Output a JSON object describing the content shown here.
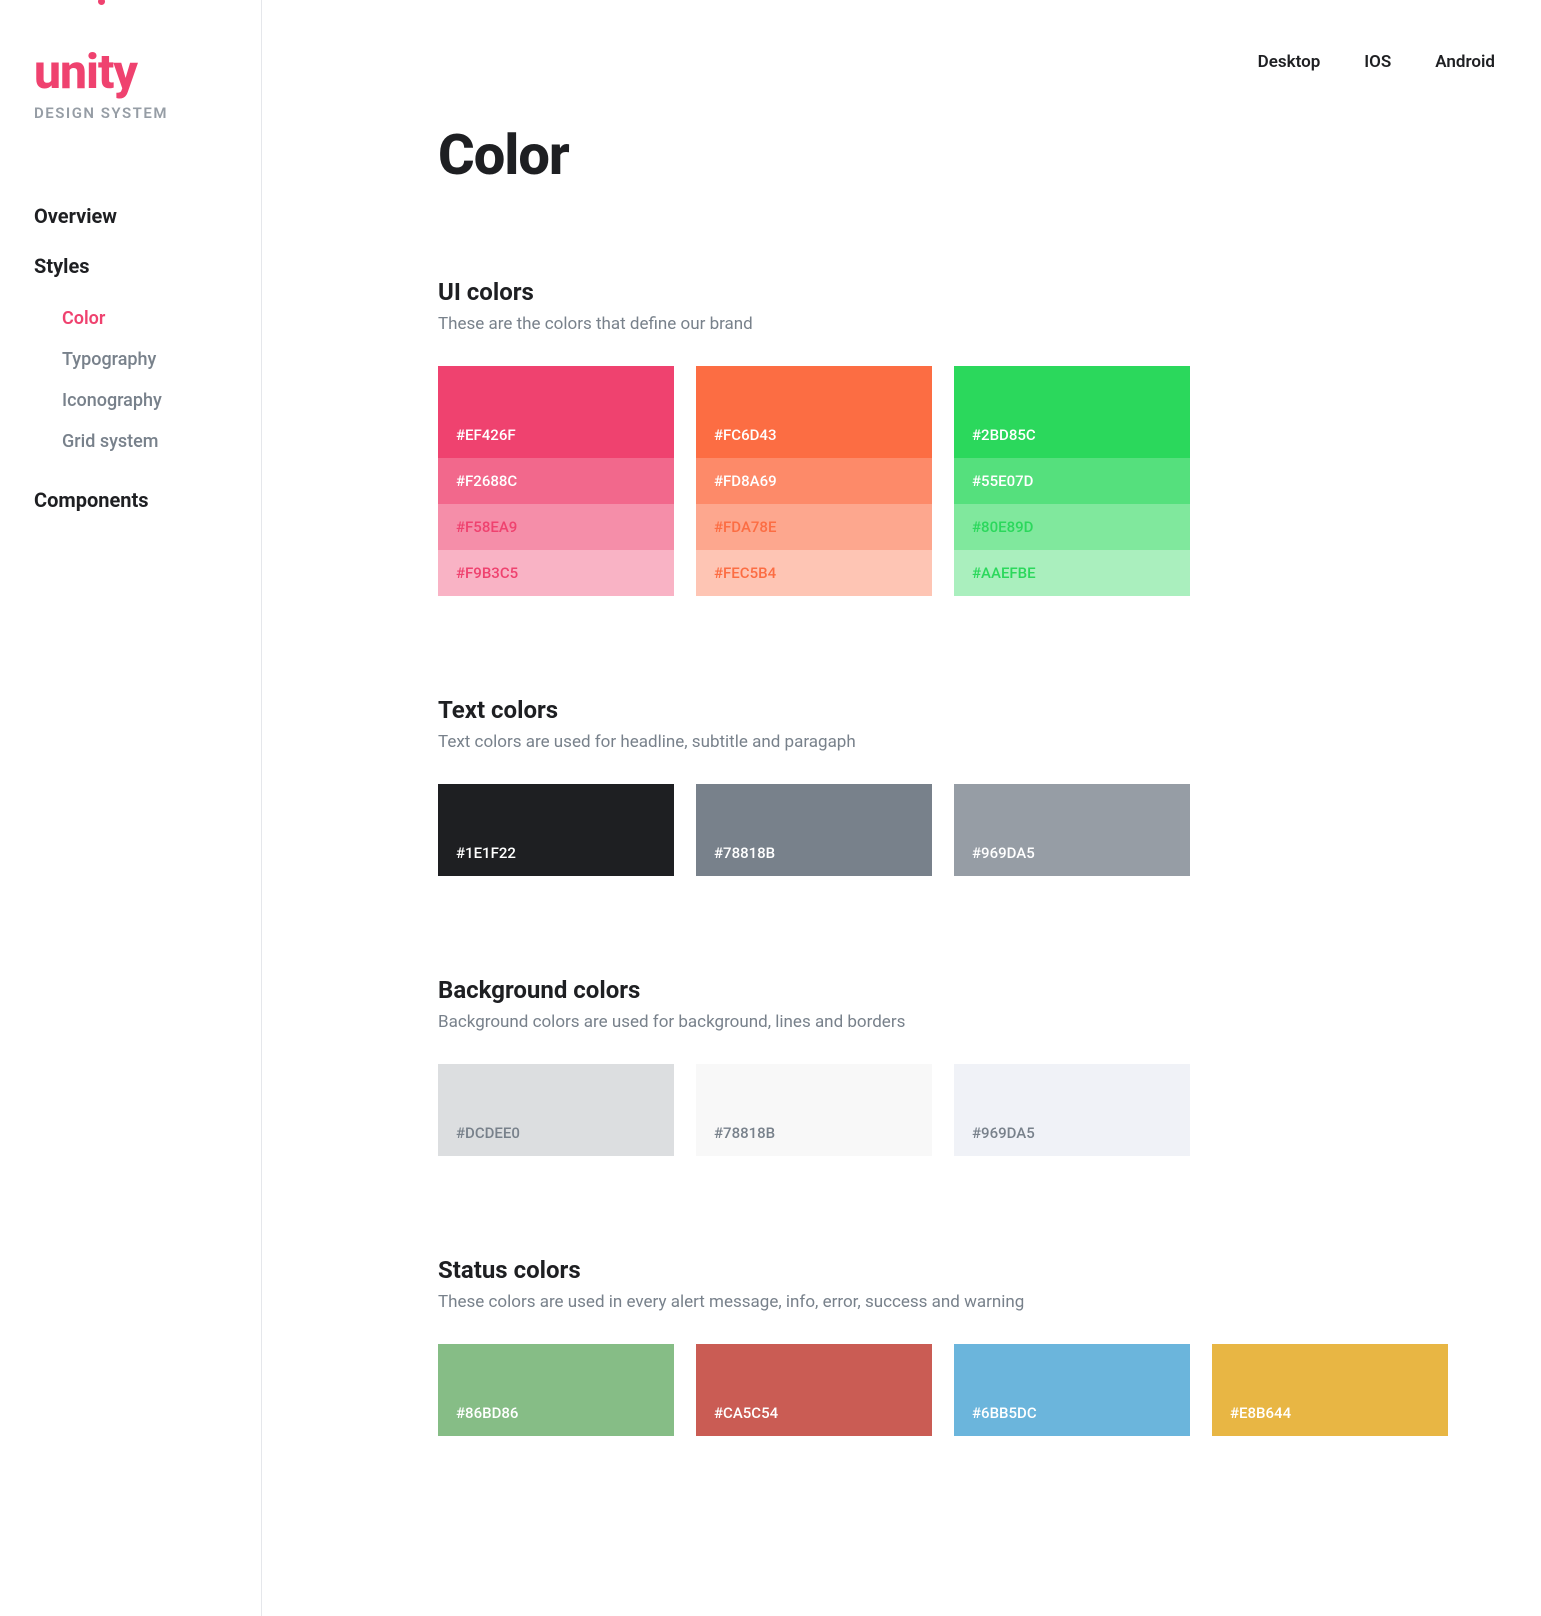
{
  "logo": {
    "text": "unity",
    "sub": "DESIGN SYSTEM"
  },
  "nav": {
    "overview": "Overview",
    "styles": "Styles",
    "styles_items": [
      "Color",
      "Typography",
      "Iconography",
      "Grid system"
    ],
    "components": "Components"
  },
  "tabs": [
    "Desktop",
    "IOS",
    "Android"
  ],
  "page_title": "Color",
  "groups": [
    {
      "title": "UI colors",
      "desc": "These are the colors that define our brand",
      "type": "shades",
      "columns": [
        {
          "shades": [
            "#EF426F",
            "#F2688C",
            "#F58EA9",
            "#F9B3C5"
          ],
          "text_on_shades": [
            "#fff",
            "#fff",
            "#EF426F",
            "#EF426F"
          ]
        },
        {
          "shades": [
            "#FC6D43",
            "#FD8A69",
            "#FDA78E",
            "#FEC5B4"
          ],
          "text_on_shades": [
            "#fff",
            "#fff",
            "#FC6D43",
            "#FC6D43"
          ]
        },
        {
          "shades": [
            "#2BD85C",
            "#55E07D",
            "#80E89D",
            "#AAEFBE"
          ],
          "text_on_shades": [
            "#fff",
            "#fff",
            "#2BD85C",
            "#2BD85C"
          ]
        }
      ]
    },
    {
      "title": "Text colors",
      "desc": "Text colors are used for headline, subtitle and paragaph",
      "type": "simple",
      "columns": [
        {
          "bg": "#1E1F22",
          "label": "#1E1F22",
          "text": "#fff"
        },
        {
          "bg": "#78818B",
          "label": "#78818B",
          "text": "#fff"
        },
        {
          "bg": "#969DA5",
          "label": "#969DA5",
          "text": "#fff"
        }
      ]
    },
    {
      "title": "Background colors",
      "desc": "Background colors are used for background, lines and borders",
      "type": "simple",
      "columns": [
        {
          "bg": "#DCDEE0",
          "label": "#DCDEE0",
          "text": "#78818b"
        },
        {
          "bg": "#F8F8F8",
          "label": "#78818B",
          "text": "#78818b"
        },
        {
          "bg": "#F0F2F7",
          "label": "#969DA5",
          "text": "#78818b"
        }
      ]
    },
    {
      "title": "Status colors",
      "desc": "These colors are used in every alert message, info, error, success and warning",
      "type": "simple",
      "columns": [
        {
          "bg": "#86BD86",
          "label": "#86BD86",
          "text": "#fff"
        },
        {
          "bg": "#CA5C54",
          "label": "#CA5C54",
          "text": "#fff"
        },
        {
          "bg": "#6BB5DC",
          "label": "#6BB5DC",
          "text": "#fff"
        },
        {
          "bg": "#E8B644",
          "label": "#E8B644",
          "text": "#fff"
        }
      ]
    }
  ]
}
